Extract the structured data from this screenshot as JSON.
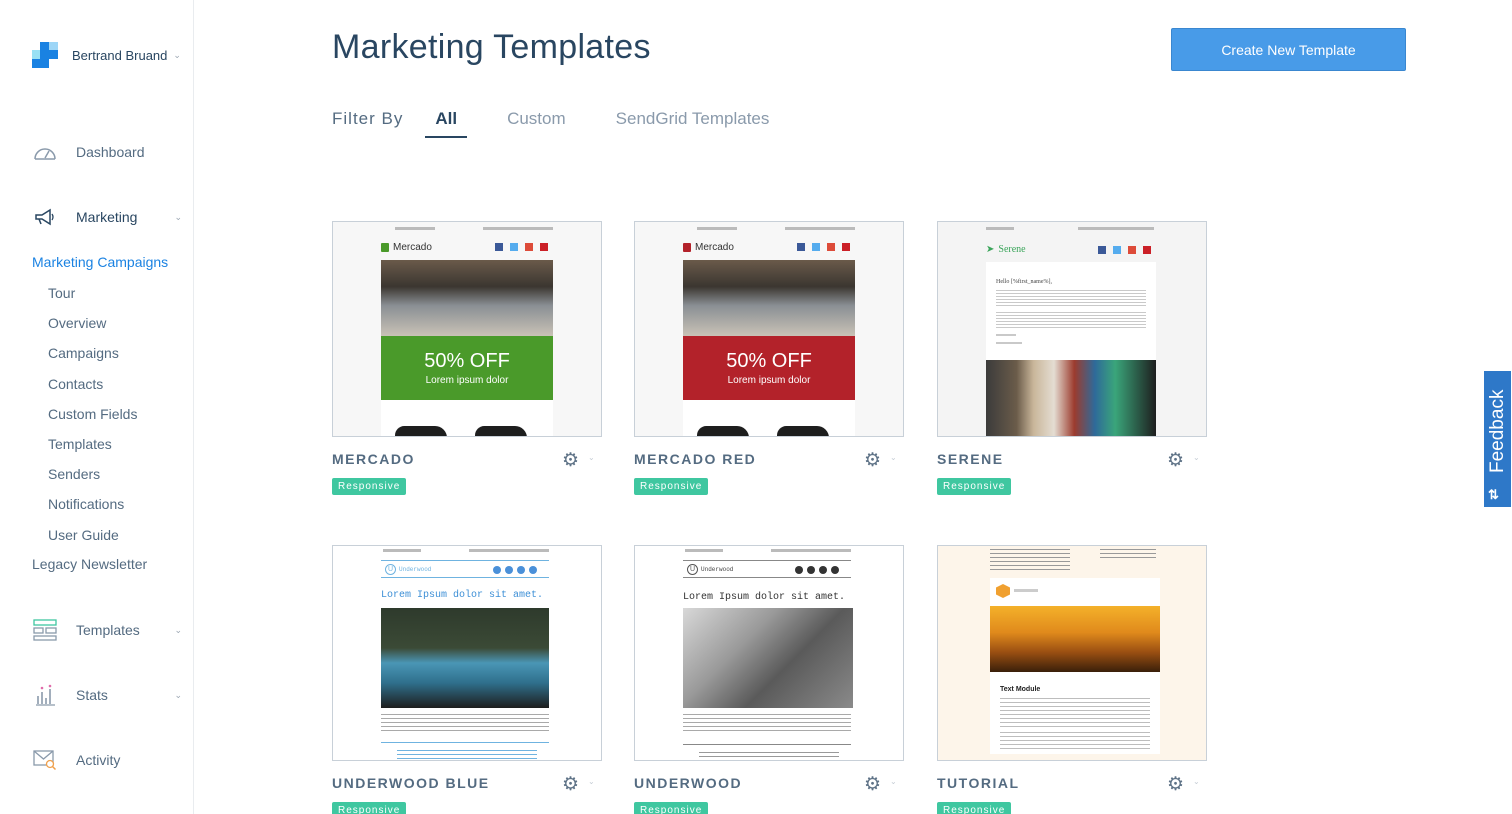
{
  "account": {
    "name": "Bertrand Bruand"
  },
  "sidebar": {
    "dashboard": "Dashboard",
    "marketing": "Marketing",
    "marketing_sub_active": "Marketing Campaigns",
    "marketing_sub": [
      "Tour",
      "Overview",
      "Campaigns",
      "Contacts",
      "Custom Fields",
      "Templates",
      "Senders",
      "Notifications",
      "User Guide"
    ],
    "legacy": "Legacy Newsletter",
    "templates": "Templates",
    "stats": "Stats",
    "activity": "Activity"
  },
  "header": {
    "title": "Marketing Templates",
    "create_button": "Create New Template"
  },
  "filter": {
    "label": "Filter By",
    "tabs": [
      "All",
      "Custom",
      "SendGrid Templates"
    ],
    "active": "All"
  },
  "templates": [
    {
      "name": "MERCADO",
      "badge": "Responsive",
      "brand": "Mercado",
      "promo_title": "50% OFF",
      "promo_sub": "Lorem ipsum dolor",
      "accent": "#4a9a2a"
    },
    {
      "name": "MERCADO RED",
      "badge": "Responsive",
      "brand": "Mercado",
      "promo_title": "50% OFF",
      "promo_sub": "Lorem ipsum dolor",
      "accent": "#b3222a"
    },
    {
      "name": "SERENE",
      "badge": "Responsive",
      "brand": "Serene",
      "greeting": "Hello [%first_name%],"
    },
    {
      "name": "UNDERWOOD BLUE",
      "badge": "Responsive",
      "brand": "Underwood",
      "headline": "Lorem Ipsum dolor sit amet."
    },
    {
      "name": "UNDERWOOD",
      "badge": "Responsive",
      "brand": "Underwood",
      "headline": "Lorem Ipsum dolor sit amet."
    },
    {
      "name": "TUTORIAL",
      "badge": "Responsive",
      "module_title": "Text Module"
    }
  ],
  "feedback": {
    "label": "Feedback"
  },
  "colors": {
    "primary": "#489be8",
    "badge": "#3fc7a0",
    "link": "#1a82e2",
    "feedback": "#2e78c8"
  }
}
